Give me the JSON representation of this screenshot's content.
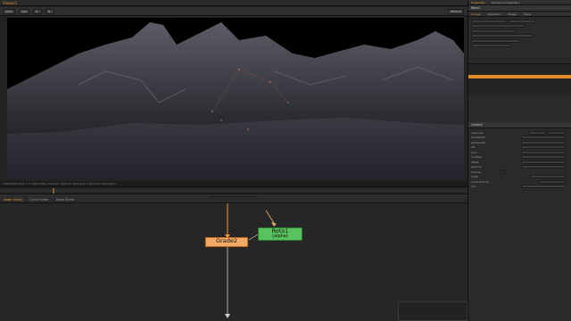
{
  "viewer": {
    "tab_label": "Viewer1",
    "toolbar_items": [
      "rgba",
      "rgb",
      "A",
      "B",
      "default"
    ],
    "info_text": "1920x1080 bbox 0 0 1920 1080 channels: rgba.red rgba.green rgba.blue rgba.alpha",
    "frame": "1001"
  },
  "node_graph": {
    "tabs": [
      "Node Graph",
      "Curve Editor",
      "Dope Sheet"
    ],
    "active_tab": "Node Graph",
    "nodes": [
      {
        "name": "Grade2",
        "color": "#f0a865"
      },
      {
        "name": "Roto1",
        "sub": "(alpha)",
        "color": "#59c25e"
      }
    ]
  },
  "properties": {
    "tabs": [
      "Properties",
      "Background Renders"
    ],
    "roto_panel": {
      "tabs": [
        "Roto1"
      ],
      "section_tabs": [
        "Curves",
        "Transform",
        "Shape",
        "Clone"
      ]
    },
    "grade_panel": {
      "title": "Grade2",
      "rows": [
        "channels",
        "blackpoint",
        "whitepoint",
        "lift",
        "gain",
        "multiply",
        "offset",
        "gamma",
        "reverse",
        "mask",
        "unpremult by",
        "mix"
      ]
    }
  },
  "colors": {
    "accent": "#e39b35",
    "grade_node": "#f0a865",
    "roto_node": "#59c25e"
  }
}
